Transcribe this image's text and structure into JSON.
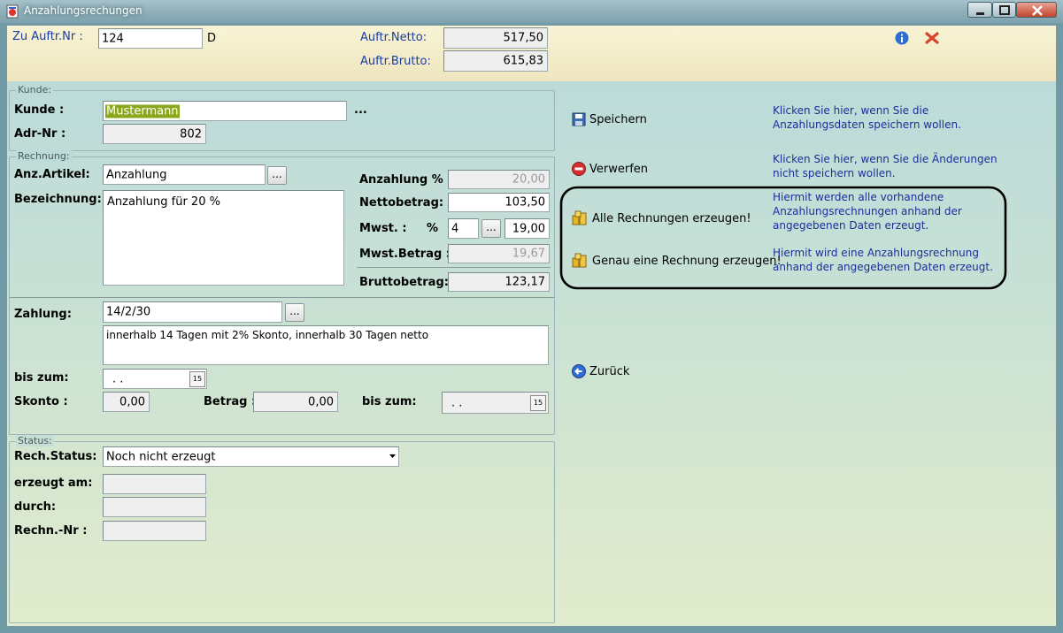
{
  "window": {
    "title": "Anzahlungsrechungen"
  },
  "header": {
    "auftr_nr_label": "Zu Auftr.Nr :",
    "auftr_nr_value": "124",
    "auftr_nr_suffix": "D",
    "netto_label": "Auftr.Netto:",
    "netto_value": "517,50",
    "brutto_label": "Auftr.Brutto:",
    "brutto_value": "615,83"
  },
  "kunde": {
    "group_label": "Kunde:",
    "kunde_label": "Kunde :",
    "kunde_value": "Mustermann",
    "kunde_more": "...",
    "adr_label": "Adr-Nr :",
    "adr_value": "802"
  },
  "rechnung": {
    "group_label": "Rechnung:",
    "artikel_label": "Anz.Artikel:",
    "artikel_value": "Anzahlung",
    "artikel_btn": "...",
    "bez_label": "Bezeichnung:",
    "bez_value": "Anzahlung für 20 %",
    "anz_pct_label": "Anzahlung % :",
    "anz_pct_value": "20,00",
    "netto_label": "Nettobetrag:",
    "netto_value": "103,50",
    "mwst_label": "Mwst. :",
    "mwst_pct_label": "%",
    "mwst_code": "4",
    "mwst_btn": "...",
    "mwst_pct_value": "19,00",
    "mwst_betrag_label": "Mwst.Betrag :",
    "mwst_betrag_value": "19,67",
    "brutto_label": "Bruttobetrag:",
    "brutto_value": "123,17"
  },
  "zahlung": {
    "label": "Zahlung:",
    "value": "14/2/30",
    "btn": "...",
    "text": "innerhalb 14 Tagen mit 2% Skonto, innerhalb 30 Tagen netto",
    "bis_label": "bis zum:",
    "bis_value": ". .",
    "cal_icon": "15",
    "skonto_label": "Skonto :",
    "skonto_value": "0,00",
    "betrag_label": "Betrag :",
    "betrag_value": "0,00",
    "bis2_label": "bis zum:",
    "bis2_value": ". ."
  },
  "status": {
    "group_label": "Status:",
    "rech_label": "Rech.Status:",
    "rech_value": "Noch nicht erzeugt",
    "erzeugt_label": "erzeugt am:",
    "durch_label": "durch:",
    "rechnr_label": "Rechn.-Nr :"
  },
  "actions": {
    "save_label": "Speichern",
    "save_hint": "Klicken Sie hier, wenn Sie die Anzahlungsdaten speichern wollen.",
    "discard_label": "Verwerfen",
    "discard_hint": "Klicken Sie hier, wenn Sie die Änderungen nicht speichern wollen.",
    "all_label": "Alle Rechnungen erzeugen!",
    "all_hint": "Hiermit werden alle vorhandene Anzahlungsrechnungen anhand der angegebenen Daten erzeugt.",
    "one_label": "Genau eine Rechnung erzeugen!",
    "one_hint": "Hiermit wird eine Anzahlungsrechnung anhand der angegebenen Daten erzeugt.",
    "back_label": "Zurück"
  },
  "colors": {
    "hint_text": "#1b2f9a",
    "label_blue": "#1b3ca0",
    "highlight": "#8aa61a",
    "close_red": "#d8442a"
  }
}
